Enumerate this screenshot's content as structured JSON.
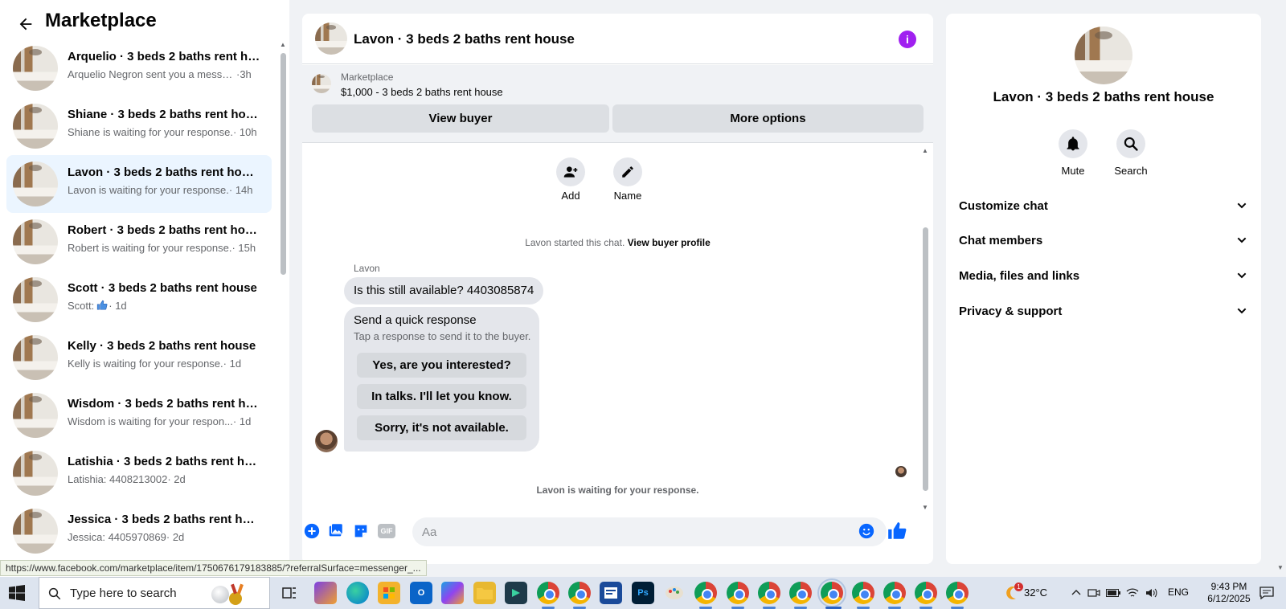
{
  "sidebar": {
    "title": "Marketplace",
    "conversations": [
      {
        "title": "Arquelio · 3 beds 2 baths rent house",
        "snippet": "Arquelio Negron sent you a messa...",
        "time": " ·3h",
        "active": false
      },
      {
        "title": "Shiane · 3 beds 2 baths rent house",
        "snippet": "Shiane is waiting for your response.",
        "time": " · 10h",
        "active": false
      },
      {
        "title": "Lavon · 3 beds 2 baths rent house",
        "snippet": "Lavon is waiting for your response.",
        "time": " · 14h",
        "active": true
      },
      {
        "title": "Robert · 3 beds 2 baths rent house",
        "snippet": "Robert is waiting for your response.",
        "time": " · 15h",
        "active": false
      },
      {
        "title": "Scott · 3 beds 2 baths rent house",
        "snippet": "Scott: ",
        "time": " · 1d",
        "active": false,
        "thumbs": true
      },
      {
        "title": "Kelly · 3 beds 2 baths rent house",
        "snippet": "Kelly is waiting for your response.",
        "time": " · 1d",
        "active": false
      },
      {
        "title": "Wisdom · 3 beds 2 baths rent house",
        "snippet": "Wisdom is waiting for your respon...",
        "time": " · 1d",
        "active": false
      },
      {
        "title": "Latishia · 3 beds 2 baths rent house",
        "snippet": "Latishia: 4408213002",
        "time": " · 2d",
        "active": false
      },
      {
        "title": "Jessica · 3 beds 2 baths rent house",
        "snippet": "Jessica: 4405970869",
        "time": " · 2d",
        "active": false
      }
    ]
  },
  "chat": {
    "title": "Lavon · 3 beds 2 baths rent house",
    "info_icon": "info-icon",
    "marketplace_label": "Marketplace",
    "listing": "$1,000 - 3 beds 2 baths rent house",
    "view_buyer": "View buyer",
    "more_options": "More options",
    "add_label": "Add",
    "name_label": "Name",
    "started_text": "Lavon started this chat.",
    "view_buyer_profile": "View buyer profile",
    "sender": "Lavon",
    "message": "Is this still available? 4403085874",
    "quick_title": "Send a quick response",
    "quick_subtitle": "Tap a response to send it to the buyer.",
    "quick_responses": [
      "Yes, are you interested?",
      "In talks. I'll let you know.",
      "Sorry, it's not available."
    ],
    "waiting": "Lavon is waiting for your response.",
    "input_placeholder": "Aa",
    "gif_label": "GIF"
  },
  "info_panel": {
    "name": "Lavon · 3 beds 2 baths rent house",
    "mute": "Mute",
    "search": "Search",
    "sections": [
      "Customize chat",
      "Chat members",
      "Media, files and links",
      "Privacy & support"
    ]
  },
  "status_url": "https://www.facebook.com/marketplace/item/1750676179183885/?referralSurface=messenger_...",
  "taskbar": {
    "search_placeholder": "Type here to search",
    "temperature": "32°C",
    "language": "ENG",
    "time": "9:43 PM",
    "date": "6/12/2025",
    "weather_badge": "1"
  },
  "colors": {
    "accent": "#0866ff",
    "active_row": "#ebf5ff",
    "info_purple": "#a020f0"
  }
}
